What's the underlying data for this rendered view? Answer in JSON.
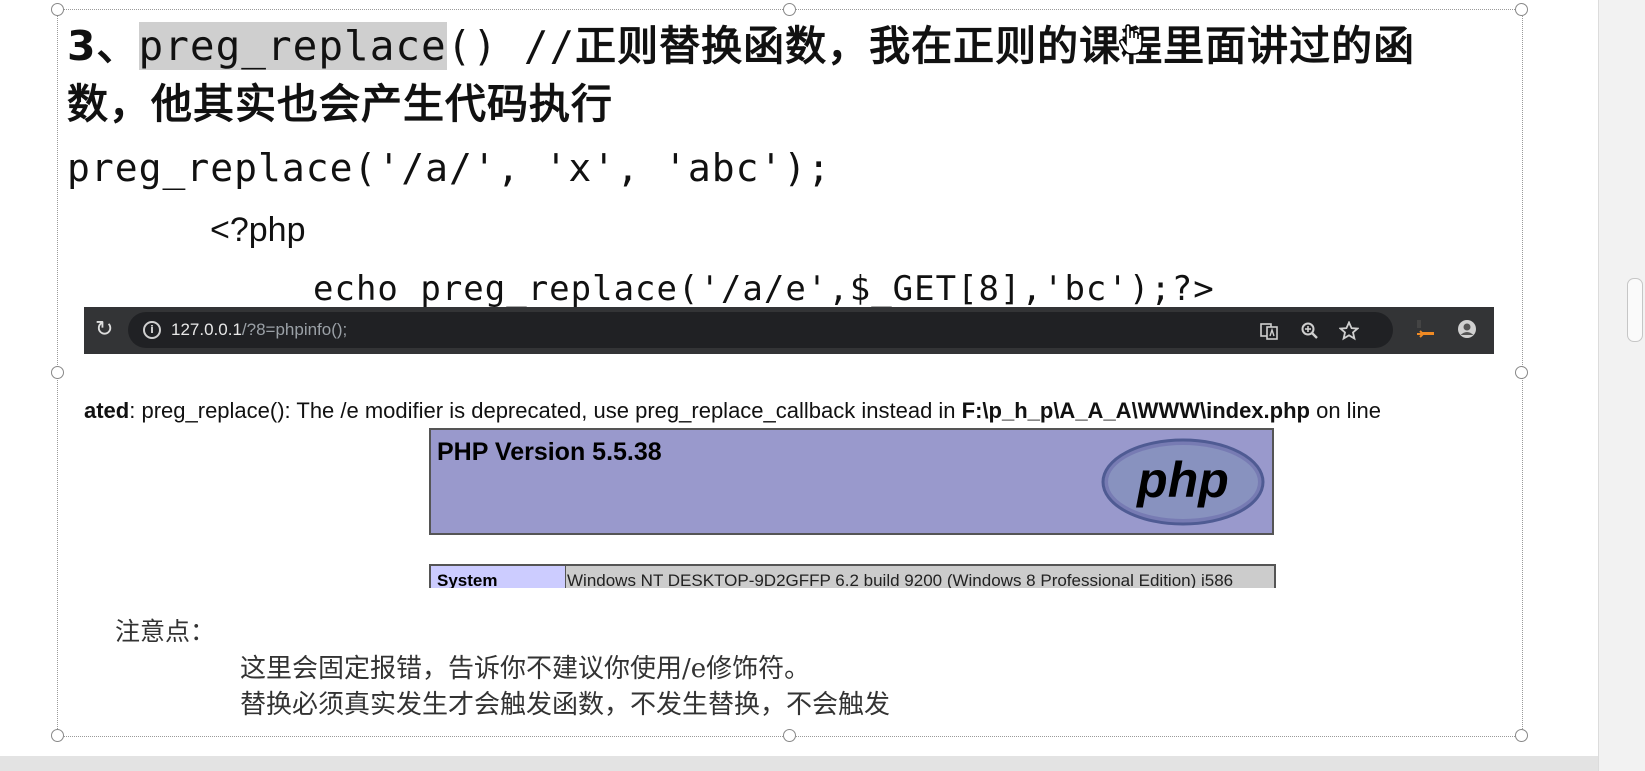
{
  "slide": {
    "heading_number": "3、",
    "heading_func": "preg_replace",
    "heading_paren": "() //",
    "heading_rest": "正则替换函数，我在正则的课程里面讲过的函",
    "heading_line2": "数，他其实也会产生代码执行",
    "code_example": "preg_replace('/a/', 'x', 'abc');",
    "php_open": "<?php",
    "php_echo": "echo preg_replace('/a/e',$_GET[8],'bc');?>"
  },
  "browser": {
    "url_host": "127.0.0.1",
    "url_path": "/?8=phpinfo();",
    "icons": [
      "reload-icon",
      "info-icon",
      "translate-icon",
      "zoom-icon",
      "star-icon",
      "extension-icon",
      "profile-icon"
    ]
  },
  "warning": {
    "prefix": "ated",
    "message": ": preg_replace(): The /e modifier is deprecated, use preg_replace_callback instead in ",
    "path": "F:\\p_h_p\\A_A_A\\WWW\\index.php",
    "suffix": " on line"
  },
  "phpinfo": {
    "version": "PHP Version 5.5.38",
    "logo_text": "php",
    "system_key": "System",
    "system_value": "Windows NT DESKTOP-9D2GFFP 6.2 build 9200 (Windows 8 Professional Edition) i586"
  },
  "notes": {
    "title": "注意点：",
    "line1": "这里会固定报错，告诉你不建议你使用/e修饰符。",
    "line2": "替换必须真实发生才会触发函数，不发生替换，不会触发"
  },
  "colors": {
    "php_header": "#9999cc",
    "php_key": "#ccccff",
    "browser_bar": "#333436",
    "highlight": "#cfcfcf"
  }
}
